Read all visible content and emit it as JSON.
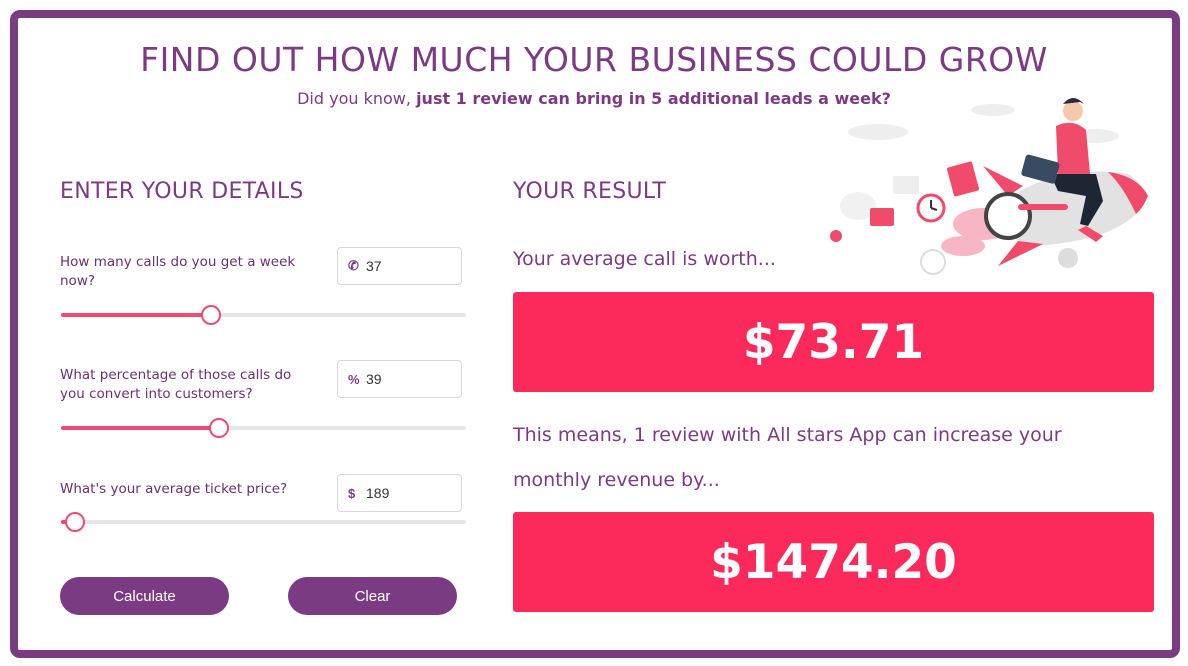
{
  "header": {
    "title": "FIND OUT HOW MUCH YOUR BUSINESS COULD GROW",
    "subtitle_prefix": "Did you know,",
    "subtitle_bold": "just 1 review can bring in 5 additional leads a week?"
  },
  "details": {
    "title": "ENTER YOUR DETAILS",
    "fields": [
      {
        "label": "How many calls do you get a week now?",
        "prefix_icon": "phone-icon",
        "prefix_symbol": "✆",
        "value": "37",
        "slider_fraction": 0.37
      },
      {
        "label": "What percentage of those calls do you convert into customers?",
        "prefix_icon": "percent-icon",
        "prefix_symbol": "%",
        "value": "39",
        "slider_fraction": 0.39
      },
      {
        "label": "What's your average ticket price?",
        "prefix_icon": "dollar-icon",
        "prefix_symbol": "$",
        "value": "189",
        "slider_fraction": 0.035
      }
    ],
    "calculate_label": "Calculate",
    "clear_label": "Clear"
  },
  "result": {
    "title": "YOUR RESULT",
    "call_worth_label": "Your average call is worth...",
    "call_worth_value": "$73.71",
    "increase_label_line1": "This means, 1 review with All stars App can increase your",
    "increase_label_line2": "monthly revenue by...",
    "increase_value": "$1474.20"
  },
  "colors": {
    "brand_purple": "#7b3b82",
    "accent_pink": "#fb2a5b",
    "slider_pink": "#ef4a6f"
  },
  "illustration": {
    "icon": "rocket-man-illustration"
  }
}
